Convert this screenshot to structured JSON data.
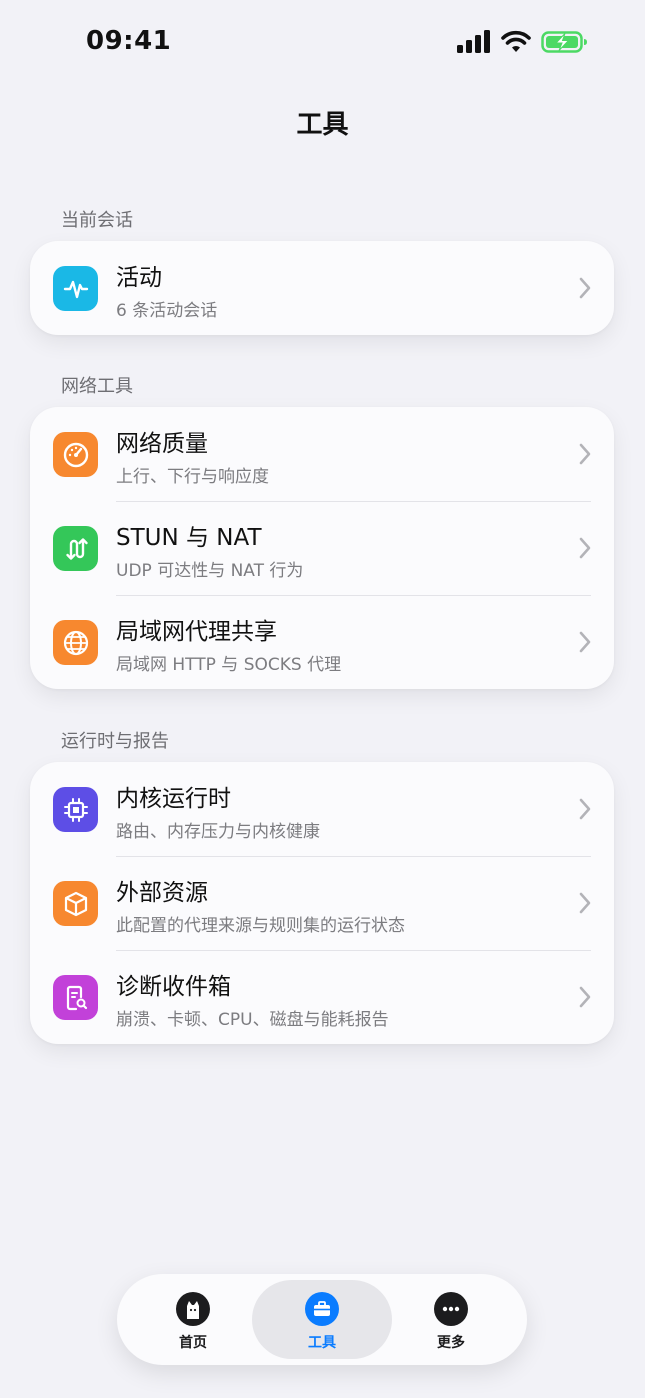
{
  "status": {
    "time": "09:41"
  },
  "header": {
    "title": "工具"
  },
  "sections": [
    {
      "label": "当前会话",
      "items": [
        {
          "title": "活动",
          "subtitle": "6 条活动会话",
          "icon": "activity-waveform-icon",
          "color": "#1ab8e6"
        }
      ]
    },
    {
      "label": "网络工具",
      "items": [
        {
          "title": "网络质量",
          "subtitle": "上行、下行与响应度",
          "icon": "speedometer-icon",
          "color": "#f7882f"
        },
        {
          "title": "STUN 与 NAT",
          "subtitle": "UDP 可达性与 NAT 行为",
          "icon": "swap-arrows-icon",
          "color": "#34c759"
        },
        {
          "title": "局域网代理共享",
          "subtitle": "局域网 HTTP 与 SOCKS 代理",
          "icon": "globe-icon",
          "color": "#f7882f"
        }
      ]
    },
    {
      "label": "运行时与报告",
      "items": [
        {
          "title": "内核运行时",
          "subtitle": "路由、内存压力与内核健康",
          "icon": "cpu-chip-icon",
          "color": "#5d4ee6"
        },
        {
          "title": "外部资源",
          "subtitle": "此配置的代理来源与规则集的运行状态",
          "icon": "package-box-icon",
          "color": "#f7882f"
        },
        {
          "title": "诊断收件箱",
          "subtitle": "崩溃、卡顿、CPU、磁盘与能耗报告",
          "icon": "report-search-icon",
          "color": "#c241d9"
        }
      ]
    }
  ],
  "tabbar": {
    "tabs": [
      {
        "label": "首页",
        "icon": "cat-icon",
        "active": false
      },
      {
        "label": "工具",
        "icon": "toolbox-icon",
        "active": true
      },
      {
        "label": "更多",
        "icon": "ellipsis-icon",
        "active": false
      }
    ]
  },
  "colors": {
    "accent": "#0a7cff",
    "background": "#f2f2f7",
    "battery": "#4cd964"
  }
}
